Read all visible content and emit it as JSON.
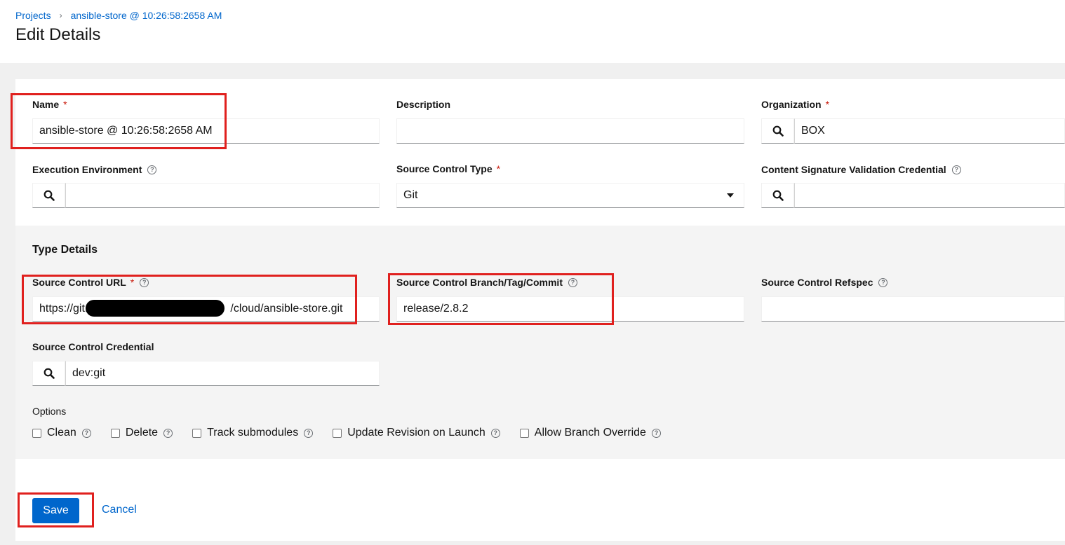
{
  "breadcrumb": {
    "projects": "Projects",
    "separator": "›",
    "current": "ansible-store @ 10:26:58:2658 AM"
  },
  "page_title": "Edit Details",
  "fields": {
    "name": {
      "label": "Name",
      "required": "*",
      "value": "ansible-store @ 10:26:58:2658 AM"
    },
    "description": {
      "label": "Description",
      "value": ""
    },
    "organization": {
      "label": "Organization",
      "required": "*",
      "value": "BOX"
    },
    "execution_environment": {
      "label": "Execution Environment",
      "value": ""
    },
    "source_control_type": {
      "label": "Source Control Type",
      "required": "*",
      "value": "Git"
    },
    "content_signature": {
      "label": "Content Signature Validation Credential",
      "value": ""
    }
  },
  "type_details": {
    "title": "Type Details",
    "source_control_url": {
      "label": "Source Control URL",
      "required": "*",
      "value_prefix": "https://git.",
      "value_suffix": "/cloud/ansible-store.git"
    },
    "branch": {
      "label": "Source Control Branch/Tag/Commit",
      "value": "release/2.8.2"
    },
    "refspec": {
      "label": "Source Control Refspec",
      "value": ""
    },
    "credential": {
      "label": "Source Control Credential",
      "value": "dev:git"
    },
    "options_label": "Options",
    "options": [
      {
        "label": "Clean",
        "checked": false
      },
      {
        "label": "Delete",
        "checked": false
      },
      {
        "label": "Track submodules",
        "checked": false
      },
      {
        "label": "Update Revision on Launch",
        "checked": false
      },
      {
        "label": "Allow Branch Override",
        "checked": false
      }
    ]
  },
  "help_icon": "?",
  "actions": {
    "save": "Save",
    "cancel": "Cancel"
  },
  "colors": {
    "accent": "#0066cc",
    "highlight": "#e0201e",
    "required": "#c9190b"
  }
}
